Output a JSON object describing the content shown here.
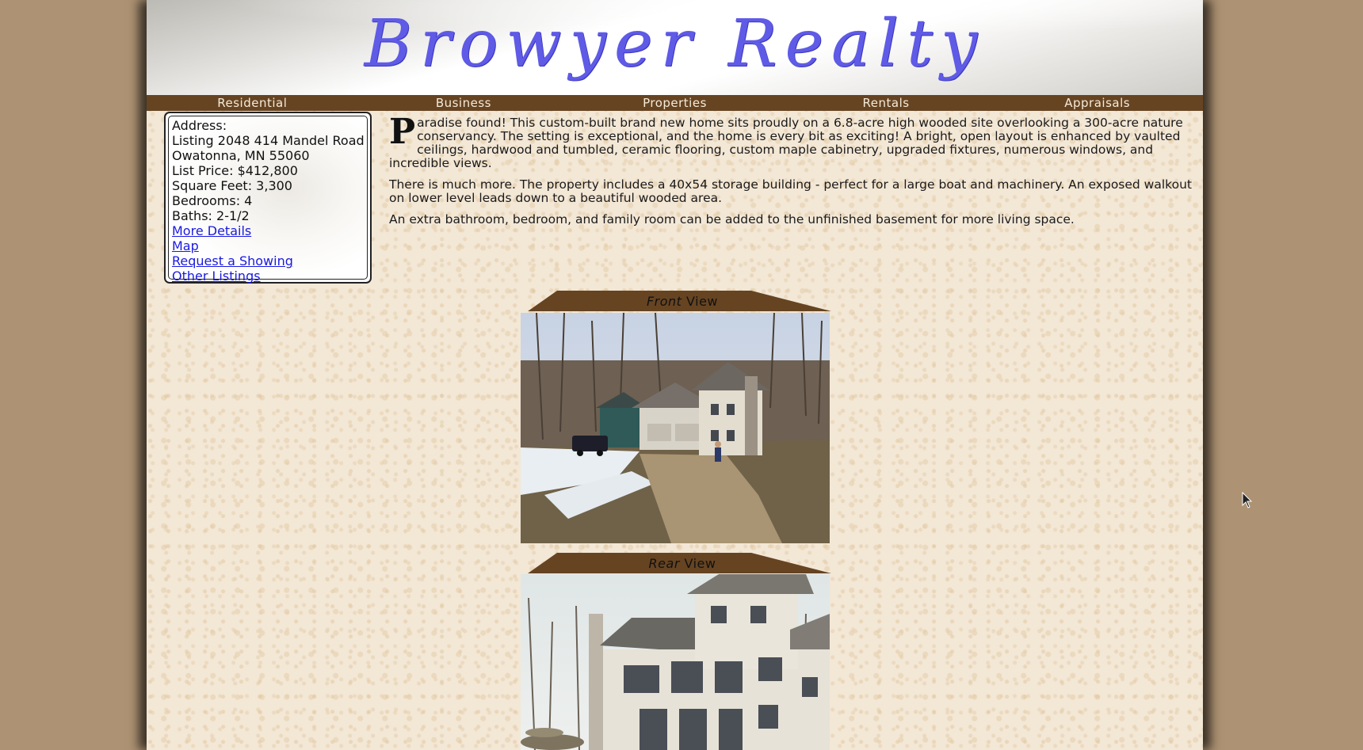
{
  "site": {
    "title": "Browyer Realty"
  },
  "nav": {
    "items": [
      "Residential",
      "Business",
      "Properties",
      "Rentals",
      "Appraisals"
    ]
  },
  "listing": {
    "address_label": "Address:",
    "listing_line": "Listing 2048 414 Mandel Road",
    "city_line": "Owatonna, MN 55060",
    "price": "List Price: $412,800",
    "square_feet": "Square Feet: 3,300",
    "bedrooms": "Bedrooms: 4",
    "baths": "Baths: 2-1/2",
    "links": {
      "more_details": "More Details",
      "map": "Map",
      "request_showing": "Request a Showing",
      "other_listings": "Other Listings"
    }
  },
  "description": {
    "dropcap": "P",
    "paragraph1": "aradise found! This custom-built brand new home sits proudly on a 6.8-acre high wooded site overlooking a 300-acre nature conservancy. The setting is exceptional, and the home is every bit as exciting! A bright, open layout is enhanced by vaulted ceilings, hardwood and tumbled, ceramic flooring, custom maple cabinetry, upgraded fixtures, numerous windows, and incredible views.",
    "paragraph2": "There is much more. The property includes a 40x54 storage building - perfect for a large boat and machinery. An exposed walkout on lower level leads down to a beautiful wooded area.",
    "paragraph3": "An extra bathroom, bedroom, and family room can be added to the unfinished basement for more living space."
  },
  "views": {
    "front": {
      "italic": "Front",
      "rest": " View"
    },
    "rear": {
      "italic": "Rear",
      "rest": " View"
    }
  },
  "colors": {
    "page_background": "#ad9273",
    "nav_background": "#664422",
    "nav_text": "#f5ead8",
    "logo": "#5f5be6",
    "link": "#1a1ae0"
  },
  "icons": {
    "cursor": "arrow-cursor-icon"
  }
}
